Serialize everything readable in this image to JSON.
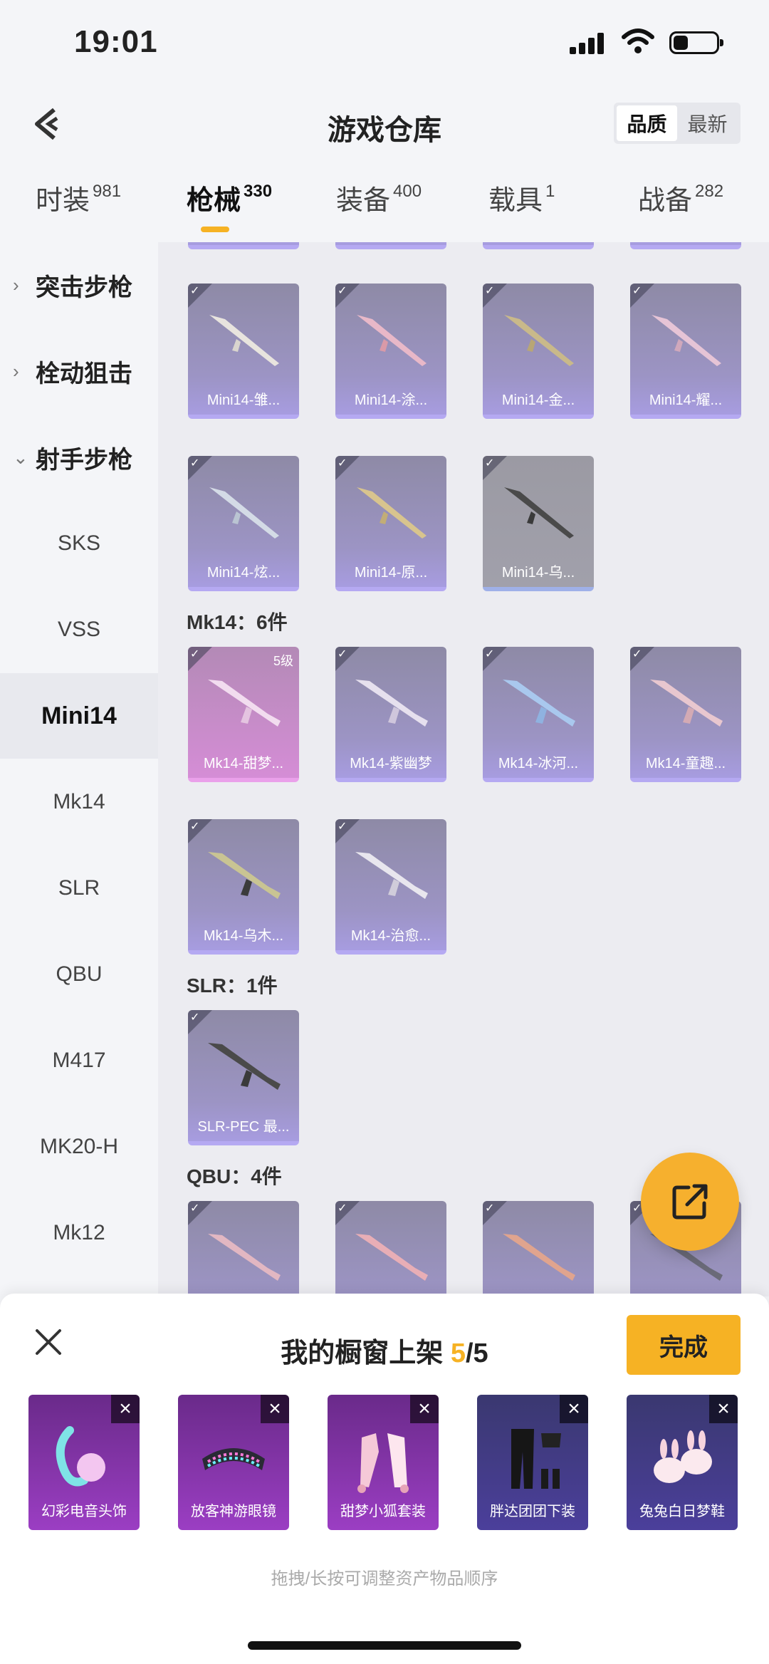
{
  "status": {
    "time": "19:01"
  },
  "header": {
    "title": "游戏仓库",
    "sort_quality": "品质",
    "sort_newest": "最新"
  },
  "tabs": [
    {
      "label": "时装",
      "count": "981"
    },
    {
      "label": "枪械",
      "count": "330"
    },
    {
      "label": "装备",
      "count": "400"
    },
    {
      "label": "载具",
      "count": "1"
    },
    {
      "label": "战备",
      "count": "282"
    }
  ],
  "sidebar": {
    "categories": [
      "突击步枪",
      "栓动狙击",
      "射手步枪"
    ],
    "items": [
      "SKS",
      "VSS",
      "Mini14",
      "Mk14",
      "SLR",
      "QBU",
      "M417",
      "MK20-H",
      "Mk12"
    ]
  },
  "content": {
    "mini14_cards": [
      "Mini14-雏...",
      "Mini14-涂...",
      "Mini14-金...",
      "Mini14-耀...",
      "Mini14-炫...",
      "Mini14-原...",
      "Mini14-乌..."
    ],
    "mk14_title": "Mk14：6件",
    "mk14_level": "5级",
    "mk14_cards": [
      "Mk14-甜梦...",
      "Mk14-紫幽梦",
      "Mk14-冰河...",
      "Mk14-童趣...",
      "Mk14-乌木...",
      "Mk14-治愈..."
    ],
    "slr_title": "SLR：1件",
    "slr_cards": [
      "SLR-PEC 最..."
    ],
    "qbu_title": "QBU：4件"
  },
  "sheet": {
    "title_prefix": "我的橱窗上架 ",
    "current": "5",
    "total": "/5",
    "done": "完成",
    "items": [
      "幻彩电音头饰",
      "放客神游眼镜",
      "甜梦小狐套装",
      "胖达团团下装",
      "兔兔白日梦鞋"
    ],
    "hint": "拖拽/长按可调整资产物品顺序"
  },
  "colors": {
    "accent": "#f6b224",
    "card_purple": "#a79ce0"
  }
}
